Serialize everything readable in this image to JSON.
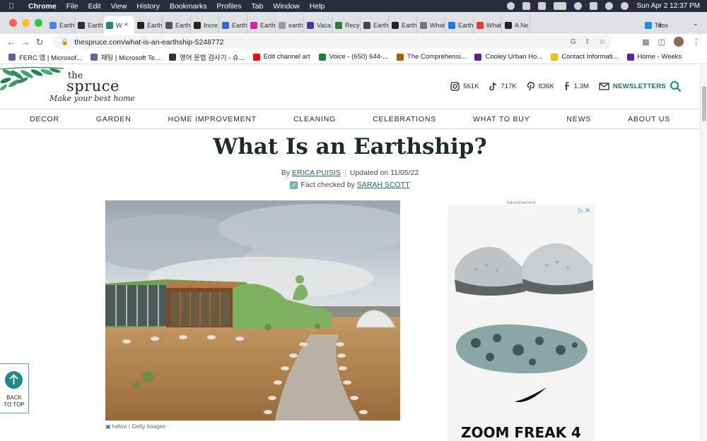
{
  "menubar": {
    "app": "Chrome",
    "items": [
      "File",
      "Edit",
      "View",
      "History",
      "Bookmarks",
      "Profiles",
      "Tab",
      "Window",
      "Help"
    ],
    "datetime": "Sun Apr 2  12:37 PM"
  },
  "tabs": [
    {
      "label": "Earth",
      "color": "#4285f4"
    },
    {
      "label": "Earth",
      "color": "#333333"
    },
    {
      "label": "W",
      "color": "#1a8a8a",
      "active": true
    },
    {
      "label": "Earth",
      "color": "#222222"
    },
    {
      "label": "Earth",
      "color": "#555555"
    },
    {
      "label": "Incre",
      "color": "#222222"
    },
    {
      "label": "Earth",
      "color": "#3367d6"
    },
    {
      "label": "Earth",
      "color": "#d6249f"
    },
    {
      "label": "earth",
      "color": "#999999"
    },
    {
      "label": "Vaca",
      "color": "#4a3aa8"
    },
    {
      "label": "Recy",
      "color": "#2e7d32"
    },
    {
      "label": "Earth",
      "color": "#444444"
    },
    {
      "label": "Earth",
      "color": "#222222"
    },
    {
      "label": "What",
      "color": "#777777"
    },
    {
      "label": "Earth",
      "color": "#1877f2"
    },
    {
      "label": "What",
      "color": "#e53935"
    },
    {
      "label": "A Ne",
      "color": "#222222"
    }
  ],
  "extra_tab": {
    "label": "Taos",
    "color": "#1a8fd6"
  },
  "url": "thespruce.com/what-is-an-earthship-5248772",
  "bookmarks": [
    {
      "label": "FERC 앱 | Microsof...",
      "color": "#6264a7"
    },
    {
      "label": "채팅 | Microsoft Te...",
      "color": "#6264a7"
    },
    {
      "label": "영어 문법 검사기 - 슈...",
      "color": "#333333"
    },
    {
      "label": "Edit channel art",
      "color": "#ff0000"
    },
    {
      "label": "Voice - (650) 644-...",
      "color": "#188038"
    },
    {
      "label": "The Comprehensi...",
      "color": "#b35c00"
    },
    {
      "label": "Cooley Urban Ho...",
      "color": "#6a1b9a"
    },
    {
      "label": "Contact Informati...",
      "color": "#fbbc04"
    },
    {
      "label": "Home - Weeks",
      "color": "#6a1b9a"
    }
  ],
  "site": {
    "logo_top": "the",
    "logo_main": "spruce",
    "tagline": "Make your best home",
    "social": [
      {
        "icon": "instagram-icon",
        "count": "561K"
      },
      {
        "icon": "tiktok-icon",
        "count": "717K"
      },
      {
        "icon": "pinterest-icon",
        "count": "836K"
      },
      {
        "icon": "facebook-icon",
        "count": "1.3M"
      }
    ],
    "newsletter": "NEWSLETTERS",
    "nav": [
      "DECOR",
      "GARDEN",
      "HOME IMPROVEMENT",
      "CLEANING",
      "CELEBRATIONS",
      "WHAT TO BUY",
      "NEWS",
      "ABOUT US"
    ]
  },
  "article": {
    "title": "What Is an Earthship?",
    "by": "By",
    "author": "ERICA PUISIS",
    "updated": "Updated on 11/05/22",
    "fact_prefix": "Fact checked by",
    "fact_checker": "SARAH SCOTT",
    "image_credit": "helovi / Getty Images"
  },
  "ad": {
    "label": "Advertisement",
    "model": "ZOOM FREAK 4"
  },
  "back_to_top": {
    "line1": "BACK",
    "line2": "TO TOP"
  },
  "colors": {
    "accent": "#1a6a6a",
    "back_to_top": "#1a8a8a"
  }
}
